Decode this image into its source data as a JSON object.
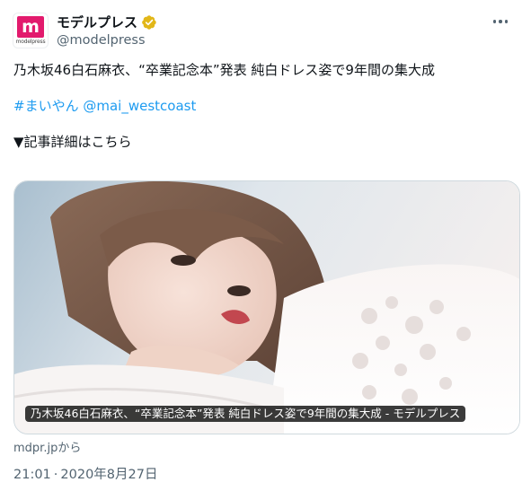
{
  "account": {
    "display_name": "モデルプレス",
    "handle": "@modelpress",
    "avatar_logo_letter": "m",
    "avatar_logo_word": "modelpress",
    "verified_icon": "verified-badge-gold",
    "more_icon": "more-dots-icon"
  },
  "tweet": {
    "line1": "乃木坂46白石麻衣、“卒業記念本”発表 純白ドレス姿で9年間の集大成",
    "hashtag": "#まいやん",
    "mention": "@mai_westcoast",
    "line3": "▼記事詳細はこちら"
  },
  "card": {
    "title": "乃木坂46白石麻衣、“卒業記念本”発表 純白ドレス姿で9年間の集大成 - モデルプレス",
    "source": "mdpr.jpから"
  },
  "meta": {
    "time": "21:01",
    "separator": "·",
    "date": "2020年8月27日"
  },
  "colors": {
    "text": "#0f1419",
    "secondary": "#536471",
    "link": "#1d9bf0",
    "brand": "#e21a6d",
    "verified": "#e2b719"
  }
}
